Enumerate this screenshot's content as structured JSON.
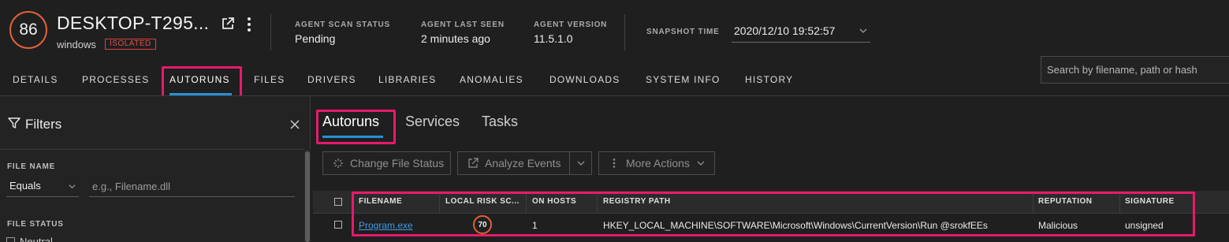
{
  "header": {
    "risk_score": "86",
    "host_name": "DESKTOP-T295...",
    "os": "windows",
    "isolated_badge": "ISOLATED",
    "agent_scan_status": {
      "label": "AGENT SCAN STATUS",
      "value": "Pending"
    },
    "agent_last_seen": {
      "label": "AGENT LAST SEEN",
      "value": "2 minutes ago"
    },
    "agent_version": {
      "label": "AGENT VERSION",
      "value": "11.5.1.0"
    },
    "snapshot_time": {
      "label": "SNAPSHOT TIME",
      "value": "2020/12/10 19:52:57"
    }
  },
  "tabs": [
    {
      "label": "DETAILS"
    },
    {
      "label": "PROCESSES"
    },
    {
      "label": "AUTORUNS",
      "active": true
    },
    {
      "label": "FILES"
    },
    {
      "label": "DRIVERS"
    },
    {
      "label": "LIBRARIES"
    },
    {
      "label": "ANOMALIES"
    },
    {
      "label": "DOWNLOADS"
    },
    {
      "label": "SYSTEM INFO"
    },
    {
      "label": "HISTORY"
    }
  ],
  "search": {
    "placeholder": "Search by filename, path or hash"
  },
  "filters": {
    "title": "Filters",
    "file_name_label": "FILE NAME",
    "operator": "Equals",
    "file_name_placeholder": "e.g., Filename.dll",
    "file_status_label": "FILE STATUS",
    "first_status_option": "Neutral"
  },
  "sub_tabs": [
    {
      "label": "Autoruns",
      "active": true
    },
    {
      "label": "Services"
    },
    {
      "label": "Tasks"
    }
  ],
  "actions": {
    "change_file_status": "Change File Status",
    "analyze_events": "Analyze Events",
    "more_actions": "More Actions"
  },
  "table": {
    "columns": [
      "FILENAME",
      "LOCAL RISK SC...",
      "ON HOSTS",
      "REGISTRY PATH",
      "REPUTATION",
      "SIGNATURE"
    ],
    "rows": [
      {
        "filename": "Program.exe",
        "local_risk_score": "70",
        "on_hosts": "1",
        "registry_path": "HKEY_LOCAL_MACHINE\\SOFTWARE\\Microsoft\\Windows\\CurrentVersion\\Run @srokfEEs",
        "reputation": "Malicious",
        "signature": "unsigned"
      }
    ]
  },
  "colors": {
    "background": "#1f1f1f",
    "accent": "#2a8fd8",
    "risk": "#e0613a",
    "highlight": "#e8196b",
    "isolated": "#e0504a",
    "link": "#3d9be9"
  }
}
